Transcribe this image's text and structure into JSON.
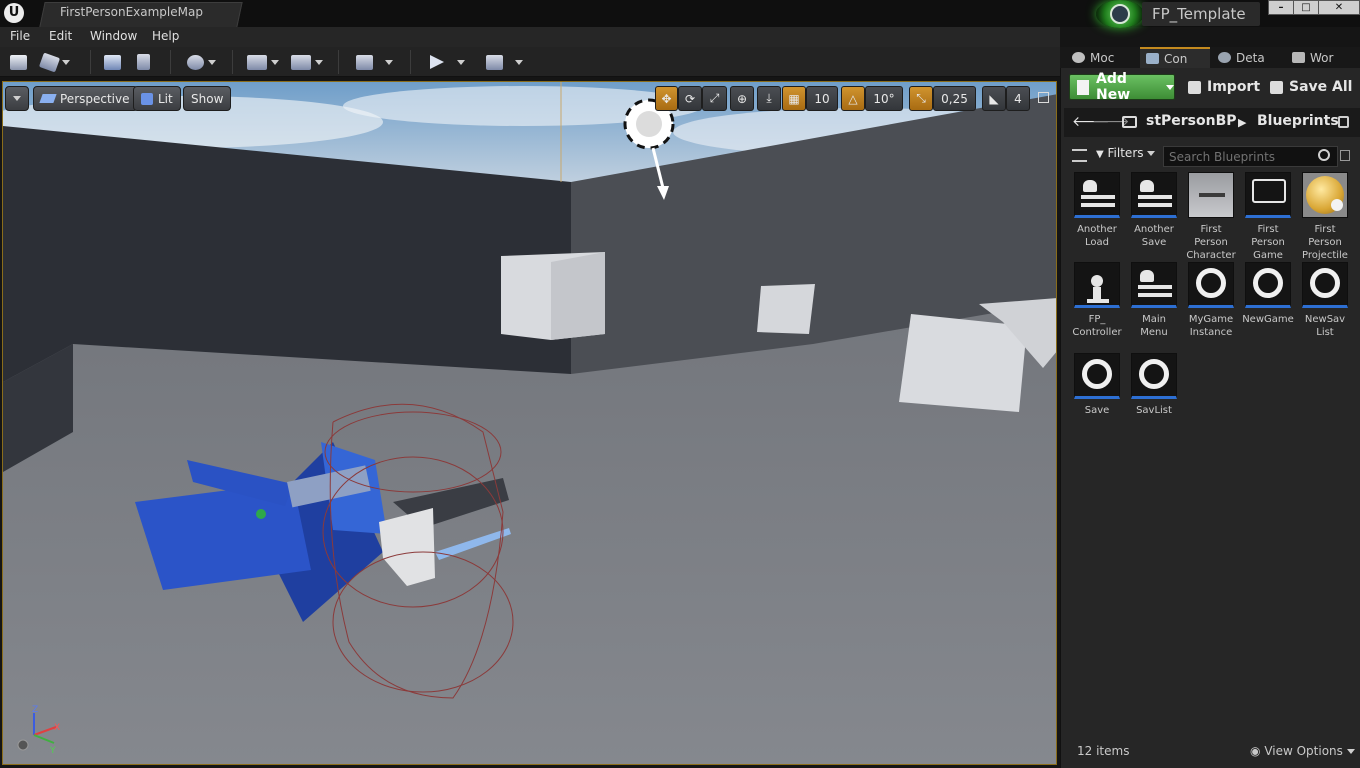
{
  "window": {
    "doc_tab": "FirstPersonExampleMap",
    "project_name": "FP_Template",
    "controls": {
      "minimize": "–",
      "maximize": "□",
      "close": "✕"
    }
  },
  "menu": [
    "File",
    "Edit",
    "Window",
    "Help"
  ],
  "viewport": {
    "view_mode": "Perspective",
    "lighting": "Lit",
    "show_label": "Show",
    "grid_snap": "10",
    "rotation_snap": "10°",
    "scale_snap": "0,25",
    "camera_speed": "4"
  },
  "right_panel": {
    "tabs": [
      "Moc",
      "Con",
      "Deta",
      "Wor"
    ],
    "add_new": "Add New",
    "import": "Import",
    "save_all": "Save All",
    "path": [
      "stPersonBP",
      "Blueprints"
    ],
    "filters": "Filters",
    "search_placeholder": "Search Blueprints",
    "assets": [
      {
        "label": "Another\nLoad",
        "icon": "widget-blueprint-icon"
      },
      {
        "label": "Another\nSave",
        "icon": "widget-blueprint-icon"
      },
      {
        "label": "First\nPerson\nCharacter",
        "icon": "character-thumbnail"
      },
      {
        "label": "First\nPerson\nGame",
        "icon": "gamemode-icon"
      },
      {
        "label": "First\nPerson\nProjectile",
        "icon": "projectile-sphere-thumbnail"
      },
      {
        "label": "FP_\nController",
        "icon": "player-controller-icon"
      },
      {
        "label": "Main\nMenu",
        "icon": "widget-blueprint-icon"
      },
      {
        "label": "MyGame\nInstance",
        "icon": "ring-object-icon"
      },
      {
        "label": "NewGame",
        "icon": "ring-object-icon"
      },
      {
        "label": "NewSav\nList",
        "icon": "ring-object-icon"
      },
      {
        "label": "Save",
        "icon": "ring-object-icon"
      },
      {
        "label": "SavList",
        "icon": "ring-object-icon"
      }
    ],
    "item_count": "12 items",
    "view_options": "View Options"
  },
  "colors": {
    "accent": "#c48a1f",
    "add_new": "#4fa348",
    "blueprint_tab": "#2d6fd3"
  }
}
